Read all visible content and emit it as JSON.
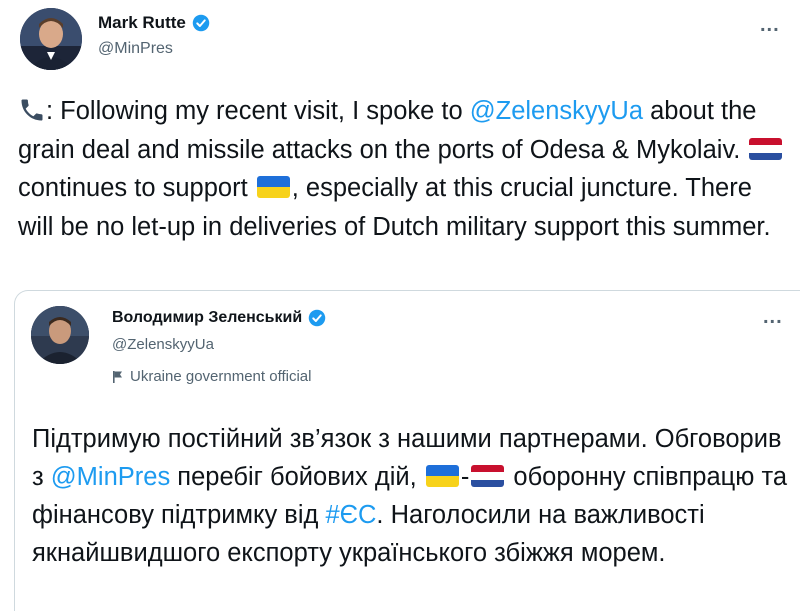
{
  "tweet1": {
    "author_name": "Mark Rutte",
    "handle": "@MinPres",
    "more_label": "...",
    "text_parts": {
      "p1": ": Following my recent visit, I spoke to ",
      "mention": "@ZelenskyyUa",
      "p2": " about the grain deal and missile attacks on the ports of Odesa & Mykolaiv. ",
      "p3": " continues to support ",
      "p4": ", especially at this crucial juncture. There will be no let-up in deliveries of Dutch military support this summer."
    },
    "icons": [
      "phone-icon",
      "netherlands-flag-icon",
      "ukraine-flag-icon"
    ]
  },
  "tweet2": {
    "author_name": "Володимир Зеленський",
    "handle": "@ZelenskyyUa",
    "label": "Ukraine government official",
    "more_label": "...",
    "text_parts": {
      "p1": "Підтримую постійний зв’язок з нашими партнерами. Обговорив з ",
      "mention": "@MinPres",
      "p2": " перебіг бойових дій, ",
      "dash": "-",
      "p3": " оборонну співпрацю та фінансову підтримку від ",
      "hashtag": "#ЄС",
      "p4": ". Наголосили на важливості якнайшвидшого експорту українського збіжжя морем."
    }
  },
  "colors": {
    "link": "#1d9bf0",
    "verified": "#1d9bf0",
    "secondary_text": "#536471"
  }
}
